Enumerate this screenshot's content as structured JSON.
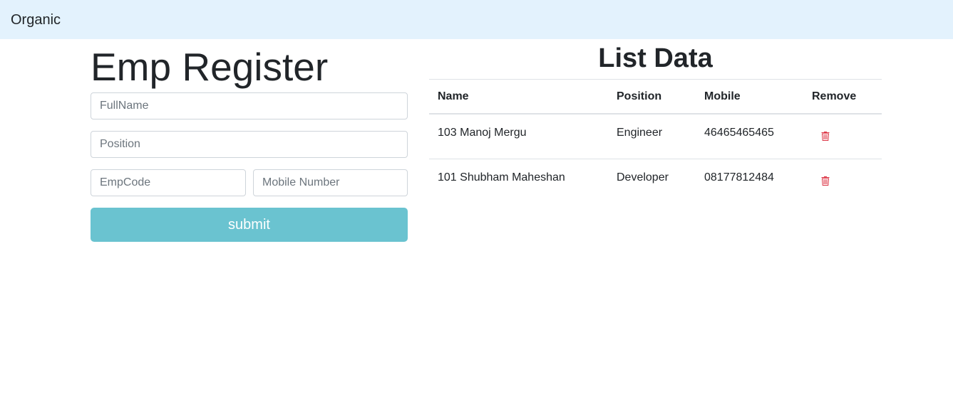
{
  "navbar": {
    "brand": "Organic",
    "background_color": "#e3f2fd"
  },
  "form": {
    "title": "Emp Register",
    "fields": {
      "fullname": {
        "placeholder": "FullName",
        "value": ""
      },
      "position": {
        "placeholder": "Position",
        "value": ""
      },
      "empcode": {
        "placeholder": "EmpCode",
        "value": ""
      },
      "mobile": {
        "placeholder": "Mobile Number",
        "value": ""
      }
    },
    "submit_label": "submit",
    "submit_color": "#6ac3d0"
  },
  "list": {
    "title": "List Data",
    "columns": [
      "Name",
      "Position",
      "Mobile",
      "Remove"
    ],
    "rows": [
      {
        "name": "103 Manoj Mergu",
        "position": "Engineer",
        "mobile": "46465465465",
        "remove_icon": "trash-icon"
      },
      {
        "name": "101 Shubham Maheshan",
        "position": "Developer",
        "mobile": "08177812484",
        "remove_icon": "trash-icon"
      }
    ],
    "remove_icon_color": "#dc3545"
  }
}
